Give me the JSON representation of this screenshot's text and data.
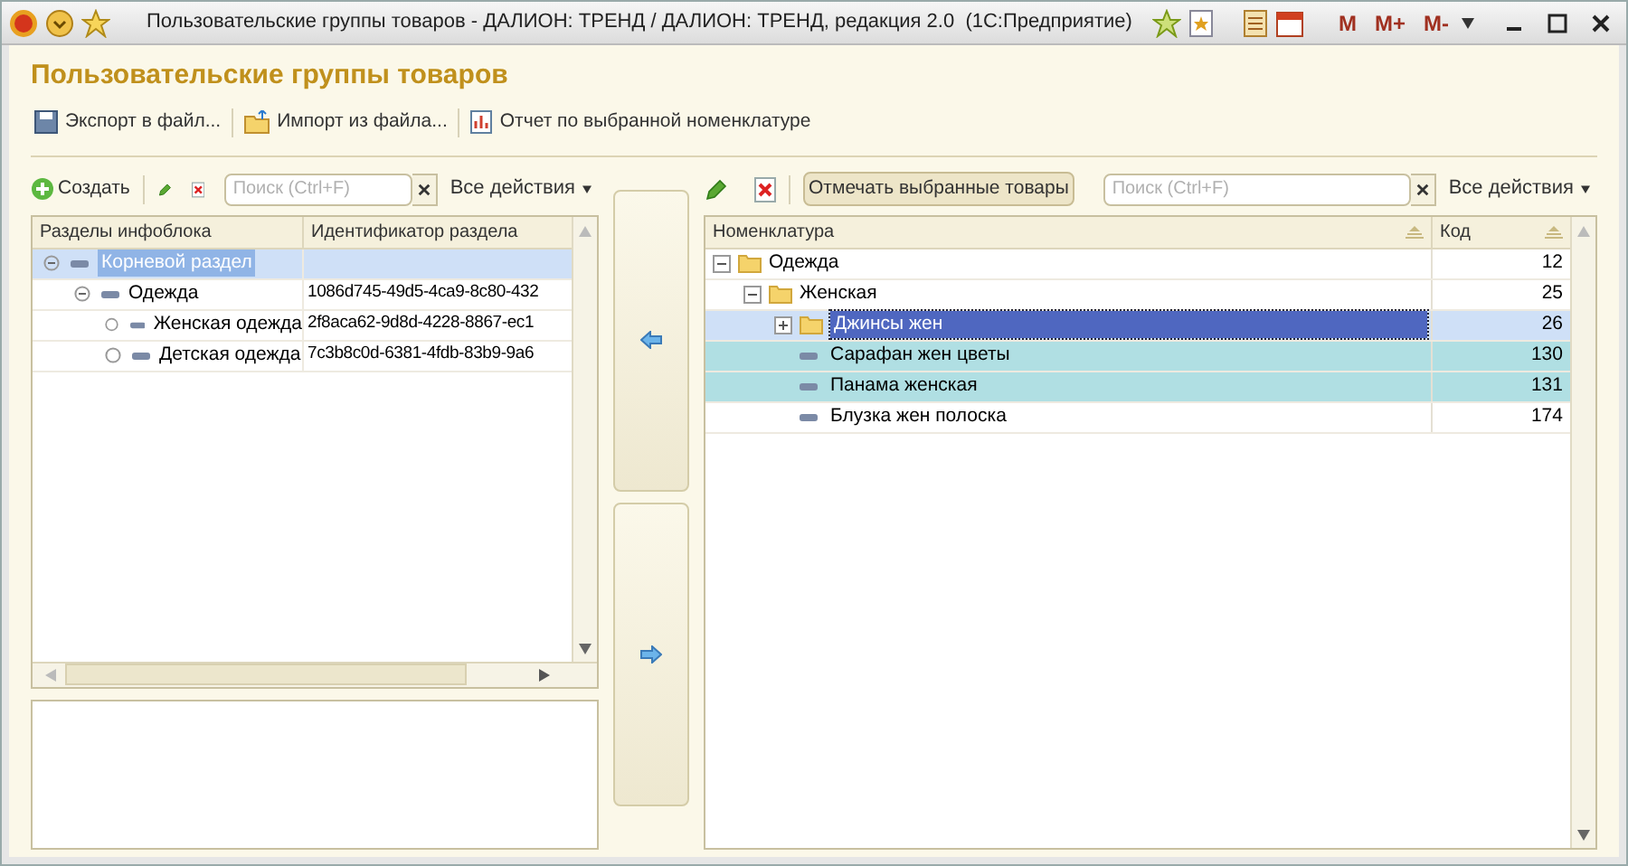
{
  "window": {
    "title": "Пользовательские группы товаров - ДАЛИОН: ТРЕНД / ДАЛИОН: ТРЕНД, редакция 2.0  (1С:Предприятие)",
    "memory_buttons": [
      "M",
      "M+",
      "M-"
    ]
  },
  "form": {
    "title": "Пользовательские группы товаров",
    "commands": [
      "Экспорт в файл...",
      "Импорт из файла...",
      "Отчет по выбранной номенклатуре"
    ]
  },
  "left_panel": {
    "create_label": "Создать",
    "search": {
      "placeholder": "Поиск (Ctrl+F)"
    },
    "all_actions": "Все действия",
    "columns": [
      "Разделы инфоблока",
      "Идентификатор раздела"
    ],
    "rows": [
      {
        "name": "Корневой раздел",
        "id": "",
        "selected": true,
        "expanded": true,
        "children": [
          {
            "name": "Одежда",
            "id": "1086d745-49d5-4ca9-8c80-432",
            "selected": false,
            "expanded": true,
            "children": [
              {
                "name": "Женская одежда",
                "id": "2f8aca62-9d8d-4228-8867-ec1",
                "selected": false,
                "expanded": false
              },
              {
                "name": "Детская одежда",
                "id": "7c3b8c0d-6381-4fdb-83b9-9a6",
                "selected": false,
                "expanded": false
              }
            ]
          }
        ]
      }
    ]
  },
  "right_panel": {
    "mark_button": "Отмечать выбранные товары",
    "search": {
      "placeholder": "Поиск (Ctrl+F)"
    },
    "all_actions": "Все действия",
    "columns": [
      "Номенклатура",
      "Код"
    ],
    "rows": [
      {
        "kind": "folder",
        "name": "Одежда",
        "code": "12",
        "expanded": true,
        "selected": false,
        "marked": false,
        "children": [
          {
            "kind": "folder",
            "name": "Женская",
            "code": "25",
            "expanded": true,
            "selected": false,
            "marked": false,
            "children": [
              {
                "kind": "folder",
                "name": "Джинсы жен",
                "code": "26",
                "expanded": false,
                "selected": true,
                "marked": false
              },
              {
                "kind": "item",
                "name": "Сарафан жен цветы",
                "code": "130",
                "selected": false,
                "marked": true
              },
              {
                "kind": "item",
                "name": "Панама женская",
                "code": "131",
                "selected": false,
                "marked": true
              },
              {
                "kind": "item",
                "name": "Блузка жен полоска",
                "code": "174",
                "selected": false,
                "marked": false
              }
            ]
          }
        ]
      }
    ]
  }
}
